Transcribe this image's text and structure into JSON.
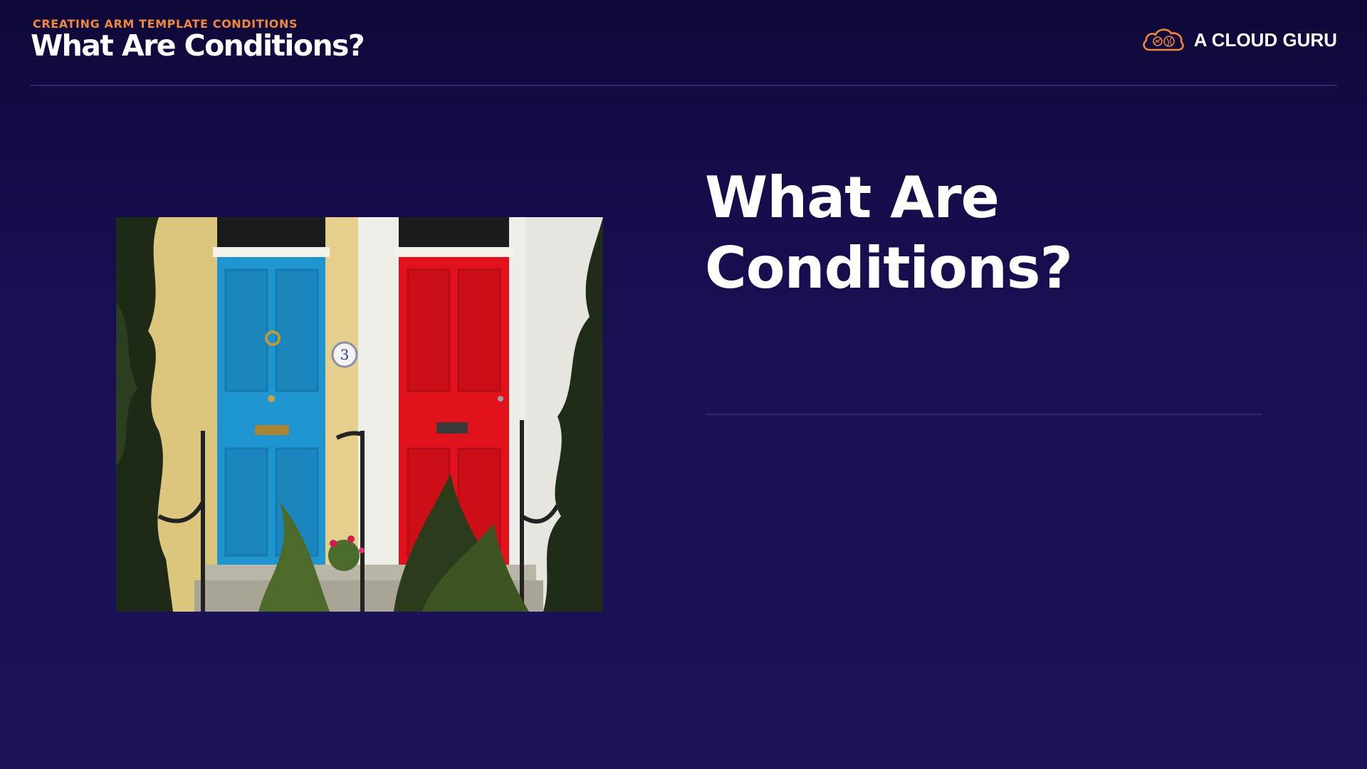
{
  "header": {
    "kicker": "CREATING ARM TEMPLATE CONDITIONS",
    "title": "What Are Conditions?"
  },
  "brand": {
    "name": "A CLOUD GURU",
    "icon": "cloud-icon",
    "accent_color": "#f0873f"
  },
  "main": {
    "heading_lines": [
      "What Are",
      "Conditions?"
    ]
  },
  "photo": {
    "description_icon": "doors-photo",
    "door_left_color": "#1f95cf",
    "door_right_color": "#e1121b",
    "house_number": "3"
  },
  "colors": {
    "background": "#1a1157",
    "accent": "#f0873f"
  }
}
